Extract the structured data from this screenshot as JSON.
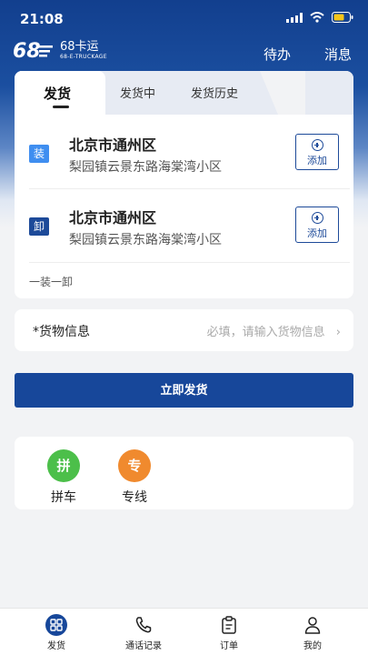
{
  "status": {
    "time": "21:08"
  },
  "header": {
    "brand": "68卡运",
    "brand_sub": "68-E-TRUCKAGE",
    "todo": "待办",
    "messages": "消息"
  },
  "tabs": [
    {
      "label": "发货"
    },
    {
      "label": "发货中"
    },
    {
      "label": "发货历史"
    }
  ],
  "addresses": [
    {
      "tag": "装",
      "tag_color": "#3f8ef0",
      "title": "北京市通州区",
      "detail": "梨园镇云景东路海棠湾小区",
      "add_label": "添加"
    },
    {
      "tag": "卸",
      "tag_color": "#1d4a99",
      "title": "北京市通州区",
      "detail": "梨园镇云景东路海棠湾小区",
      "add_label": "添加"
    }
  ],
  "mode": "一装一卸",
  "goods": {
    "label": "*货物信息",
    "placeholder": "必填，请输入货物信息"
  },
  "ship_button": "立即发货",
  "services": [
    {
      "glyph": "拼",
      "name": "拼车",
      "color": "#4cbf4a"
    },
    {
      "glyph": "专",
      "name": "专线",
      "color": "#f08a2e"
    }
  ],
  "bottom_nav": [
    {
      "label": "发货",
      "icon": "grid-icon"
    },
    {
      "label": "通话记录",
      "icon": "phone-icon"
    },
    {
      "label": "订单",
      "icon": "clipboard-icon"
    },
    {
      "label": "我的",
      "icon": "user-icon"
    }
  ],
  "colors": {
    "primary": "#17479a",
    "accent_blue": "#3f8ef0",
    "green": "#4cbf4a",
    "orange": "#f08a2e"
  }
}
